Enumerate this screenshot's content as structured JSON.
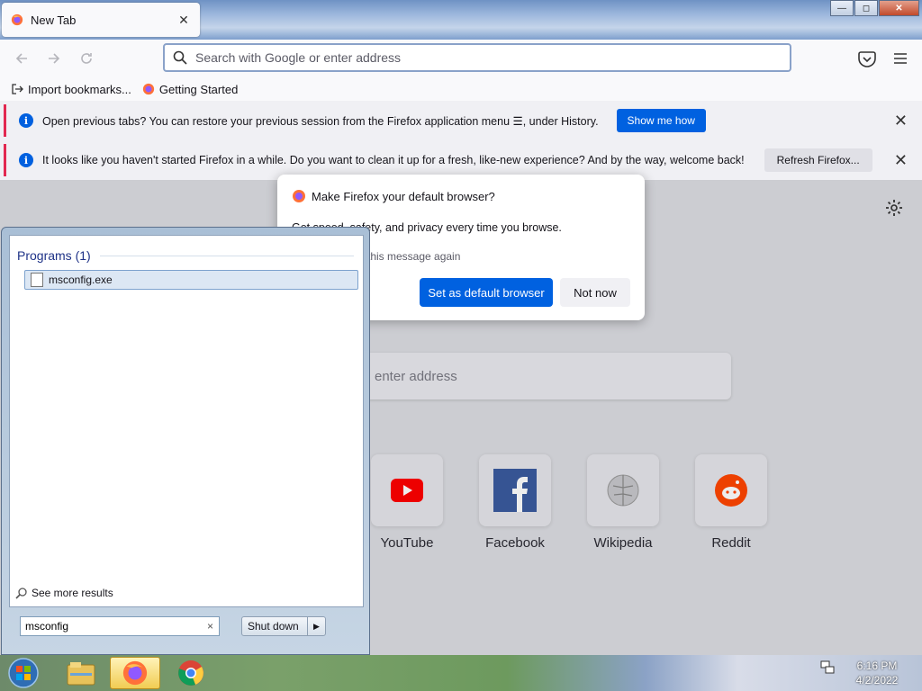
{
  "browser": {
    "tab_title": "New Tab",
    "tab_close": "✕",
    "window_controls": {
      "minimize": "—",
      "maximize": "◻",
      "close": "✕"
    },
    "urlbar_placeholder": "Search with Google or enter address",
    "bookmarks": [
      {
        "label": "Import bookmarks...",
        "icon": "import-icon"
      },
      {
        "label": "Getting Started",
        "icon": "firefox-icon"
      }
    ],
    "notifications": [
      {
        "text": "Open previous tabs? You can restore your previous session from the Firefox application menu ☰, under History.",
        "button": "Show me how"
      },
      {
        "text": "It looks like you haven't started Firefox in a while. Do you want to clean it up for a fresh, like-new experience? And by the way, welcome back!",
        "button": "Refresh Firefox..."
      }
    ],
    "newtab": {
      "search_placeholder": "enter address",
      "shortcuts": [
        {
          "name": "YouTube",
          "icon": "youtube-icon",
          "color": "#ff0000"
        },
        {
          "name": "Facebook",
          "icon": "facebook-icon",
          "color": "#1877f2"
        },
        {
          "name": "Wikipedia",
          "icon": "wikipedia-icon",
          "color": "#888888"
        },
        {
          "name": "Reddit",
          "icon": "reddit-icon",
          "color": "#ff4500"
        }
      ]
    },
    "default_dialog": {
      "title": "Make Firefox your default browser?",
      "body": "Get speed, safety, and privacy every time you browse.",
      "check": "this message again",
      "primary": "Set as default browser",
      "secondary": "Not now"
    }
  },
  "start_menu": {
    "programs_header": "Programs (1)",
    "result": "msconfig.exe",
    "see_more": "See more results",
    "search_value": "msconfig",
    "clear": "×",
    "shutdown": "Shut down"
  },
  "taskbar": {
    "time": "6:16 PM",
    "date": "4/2/2022",
    "pinned": [
      "windows-explorer-icon",
      "firefox-icon",
      "chrome-icon"
    ]
  },
  "colors": {
    "accent": "#0061e0",
    "notif_bar": "#e22850"
  }
}
